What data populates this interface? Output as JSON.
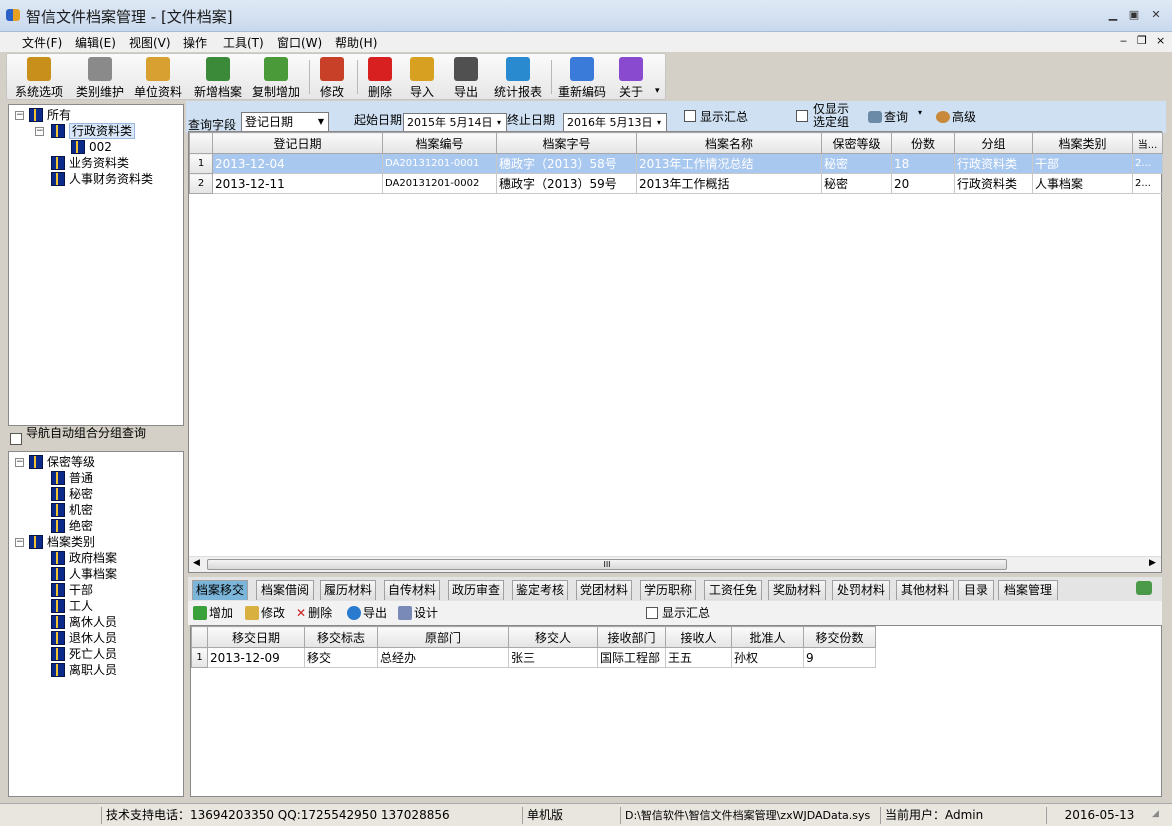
{
  "window": {
    "title": "智信文件档案管理 - [文件档案]",
    "minimize": "▁",
    "restore": "▣",
    "close": "✕"
  },
  "menu": [
    "文件(F)",
    "编辑(E)",
    "视图(V)",
    "操作",
    "工具(T)",
    "窗口(W)",
    "帮助(H)"
  ],
  "mdi_controls": [
    "‒",
    "❐",
    "×"
  ],
  "toolbar": [
    {
      "label": "系统选项",
      "icon": "key-icon",
      "color": "#c8901a"
    },
    {
      "label": "类别维护",
      "icon": "tools-icon",
      "color": "#8a8a8a"
    },
    {
      "label": "单位资料",
      "icon": "notebook-icon",
      "color": "#d8a030"
    },
    {
      "label": "新增档案",
      "icon": "add-user-icon",
      "color": "#3a8a3a"
    },
    {
      "label": "复制增加",
      "icon": "copy-add-icon",
      "color": "#4a9a3a"
    },
    {
      "label": "修改",
      "icon": "pencil-icon",
      "color": "#c84028"
    },
    {
      "label": "删除",
      "icon": "delete-icon",
      "color": "#d82020"
    },
    {
      "label": "导入",
      "icon": "import-icon",
      "color": "#d8a020"
    },
    {
      "label": "导出",
      "icon": "printer-icon",
      "color": "#505050"
    },
    {
      "label": "统计报表",
      "icon": "chart-icon",
      "color": "#2a8ad0"
    },
    {
      "label": "重新编码",
      "icon": "calendar-icon",
      "color": "#3a7ad8"
    },
    {
      "label": "关于",
      "icon": "help-icon",
      "color": "#8a4ad0"
    }
  ],
  "tree_top": [
    {
      "label": "所有",
      "level": 0,
      "expander": "−"
    },
    {
      "label": "行政资料类",
      "level": 1,
      "expander": "−",
      "selected": true
    },
    {
      "label": "002",
      "level": 2
    },
    {
      "label": "业务资料类",
      "level": 1
    },
    {
      "label": "人事财务资料类",
      "level": 1
    }
  ],
  "nav_checkbox_label": "导航自动组合分组查询",
  "tree_bottom": [
    {
      "label": "保密等级",
      "level": 0,
      "expander": "−"
    },
    {
      "label": "普通",
      "level": 1
    },
    {
      "label": "秘密",
      "level": 1
    },
    {
      "label": "机密",
      "level": 1
    },
    {
      "label": "绝密",
      "level": 1
    },
    {
      "label": "档案类别",
      "level": 0,
      "expander": "−"
    },
    {
      "label": "政府档案",
      "level": 1
    },
    {
      "label": "人事档案",
      "level": 1
    },
    {
      "label": "干部",
      "level": 1
    },
    {
      "label": "工人",
      "level": 1
    },
    {
      "label": "离休人员",
      "level": 1
    },
    {
      "label": "退休人员",
      "level": 1
    },
    {
      "label": "死亡人员",
      "level": 1
    },
    {
      "label": "离职人员",
      "level": 1
    }
  ],
  "query": {
    "field_label": "查询字段",
    "field_value": "登记日期",
    "start_label": "起始日期",
    "start_value": "2015年 5月14日",
    "end_label": "终止日期",
    "end_value": "2016年 5月13日",
    "show_summary": "显示汇总",
    "only_selected": "仅显示选定组",
    "search": "查询",
    "advanced": "高级"
  },
  "main_grid": {
    "columns": [
      "登记日期",
      "档案编号",
      "档案字号",
      "档案名称",
      "保密等级",
      "份数",
      "分组",
      "档案类别",
      "当..."
    ],
    "rows": [
      [
        "1",
        "2013-12-04",
        "DA20131201-0001",
        "穗政字（2013）58号",
        "2013年工作情况总结",
        "秘密",
        "18",
        "行政资料类",
        "干部",
        "2..."
      ],
      [
        "2",
        "2013-12-11",
        "DA20131201-0002",
        "穗政字（2013）59号",
        "2013年工作概括",
        "秘密",
        "20",
        "行政资料类",
        "人事档案",
        "2..."
      ]
    ],
    "hscroll_grip": "III"
  },
  "tabs": [
    "档案移交",
    "档案借阅",
    "履历材料",
    "自传材料",
    "政历审查",
    "鉴定考核",
    "党团材料",
    "学历职称",
    "工资任免",
    "奖励材料",
    "处罚材料",
    "其他材料",
    "目录",
    "档案管理"
  ],
  "sub_toolbar": {
    "add": "增加",
    "edit": "修改",
    "delete": "删除",
    "export": "导出",
    "design": "设计",
    "show_summary": "显示汇总"
  },
  "sub_grid": {
    "columns": [
      "移交日期",
      "移交标志",
      "原部门",
      "移交人",
      "接收部门",
      "接收人",
      "批准人",
      "移交份数"
    ],
    "rows": [
      [
        "1",
        "2013-12-09",
        "移交",
        "总经办",
        "张三",
        "国际工程部",
        "王五",
        "孙权",
        "9"
      ]
    ]
  },
  "status": {
    "support": "技术支持电话：13694203350 QQ:1725542950 137028856",
    "edition": "单机版",
    "path": "D:\\智信软件\\智信文件档案管理\\zxWJDAData.sys",
    "user": "当前用户：Admin",
    "date": "2016-05-13"
  },
  "colors": {
    "selected_row": "#a9c8ef",
    "active_tab": "#7bb5d9",
    "title_bar": "#c9d9ee"
  }
}
